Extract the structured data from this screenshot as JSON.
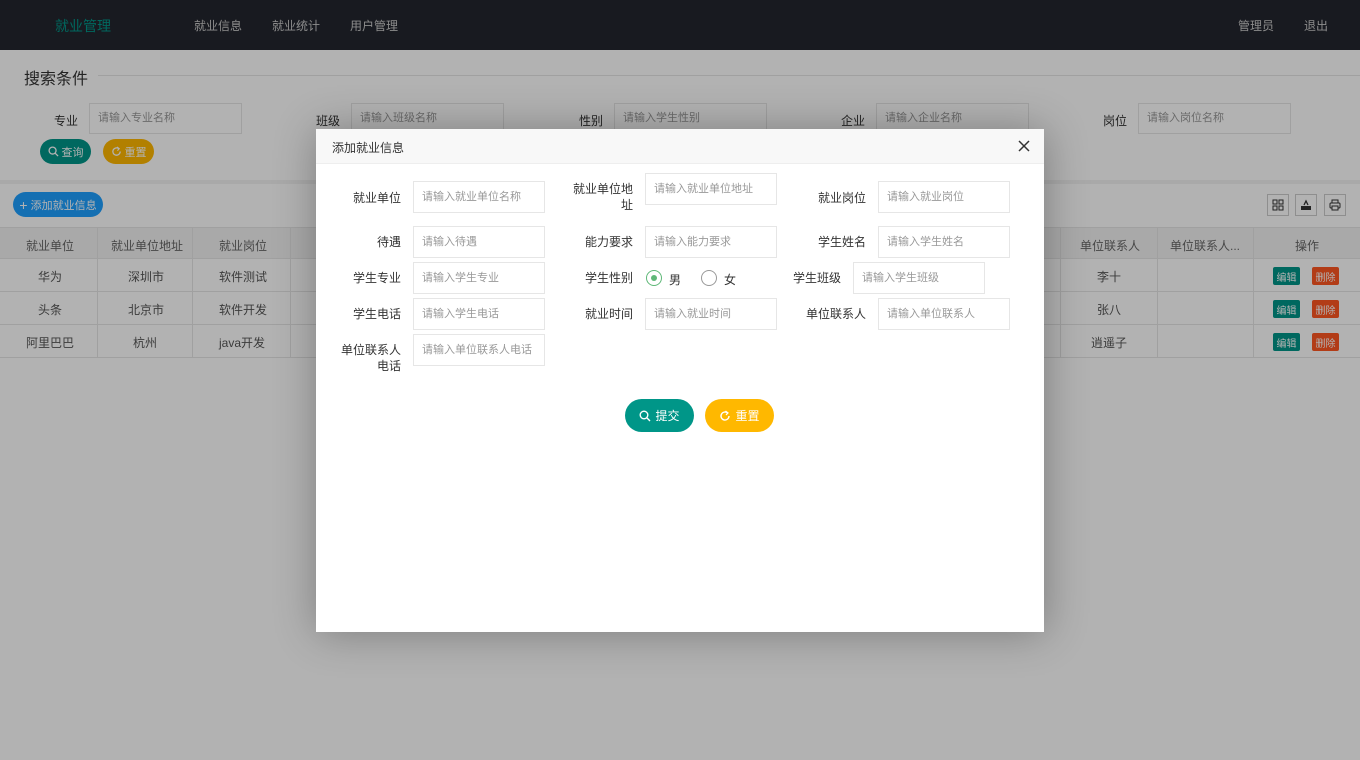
{
  "nav": {
    "brand": "就业管理",
    "items": [
      "就业信息",
      "就业统计",
      "用户管理"
    ],
    "user": "管理员",
    "logout": "退出"
  },
  "search": {
    "title": "搜索条件",
    "fields": [
      {
        "label": "专业",
        "placeholder": "请输入专业名称"
      },
      {
        "label": "班级",
        "placeholder": "请输入班级名称"
      },
      {
        "label": "性别",
        "placeholder": "请输入学生性别"
      },
      {
        "label": "企业",
        "placeholder": "请输入企业名称"
      },
      {
        "label": "岗位",
        "placeholder": "请输入岗位名称"
      }
    ],
    "query_label": "查询",
    "reset_label": "重置"
  },
  "toolbar": {
    "add_label": "添加就业信息"
  },
  "table": {
    "headers": [
      "就业单位",
      "就业单位地址",
      "就业岗位",
      "单位联系人",
      "单位联系人...",
      "操作"
    ],
    "rows": [
      {
        "company": "华为",
        "address": "深圳市",
        "position": "软件测试",
        "contact": "李十"
      },
      {
        "company": "头条",
        "address": "北京市",
        "position": "软件开发",
        "contact": "张八"
      },
      {
        "company": "阿里巴巴",
        "address": "杭州",
        "position": "java开发",
        "contact": "逍遥子"
      }
    ],
    "edit_label": "编辑",
    "delete_label": "删除"
  },
  "colors": {
    "nav_bg": "#23262e",
    "accent_green": "#009688",
    "accent_yellow": "#FFB800",
    "accent_blue": "#1E9FFF",
    "danger": "#FF5722",
    "radio_green": "#5FB878"
  },
  "modal": {
    "title": "添加就业信息",
    "close_icon": "close-icon",
    "fields": {
      "company": {
        "label": "就业单位",
        "placeholder": "请输入就业单位名称"
      },
      "address": {
        "label_line1": "就业单位地",
        "label_line2": "址",
        "placeholder": "请输入就业单位地址"
      },
      "position": {
        "label": "就业岗位",
        "placeholder": "请输入就业岗位"
      },
      "salary": {
        "label": "待遇",
        "placeholder": "请输入待遇"
      },
      "ability": {
        "label": "能力要求",
        "placeholder": "请输入能力要求"
      },
      "student_name": {
        "label": "学生姓名",
        "placeholder": "请输入学生姓名"
      },
      "major": {
        "label": "学生专业",
        "placeholder": "请输入学生专业"
      },
      "gender": {
        "label": "学生性别",
        "options": [
          "男",
          "女"
        ],
        "selected": "男"
      },
      "class": {
        "label": "学生班级",
        "placeholder": "请输入学生班级"
      },
      "phone": {
        "label": "学生电话",
        "placeholder": "请输入学生电话"
      },
      "time": {
        "label": "就业时间",
        "placeholder": "请输入就业时间"
      },
      "contact": {
        "label": "单位联系人",
        "placeholder": "请输入单位联系人"
      },
      "contact_phone": {
        "label_line1": "单位联系人",
        "label_line2": "电话",
        "placeholder": "请输入单位联系人电话"
      }
    },
    "submit_label": "提交",
    "reset_label": "重置"
  }
}
